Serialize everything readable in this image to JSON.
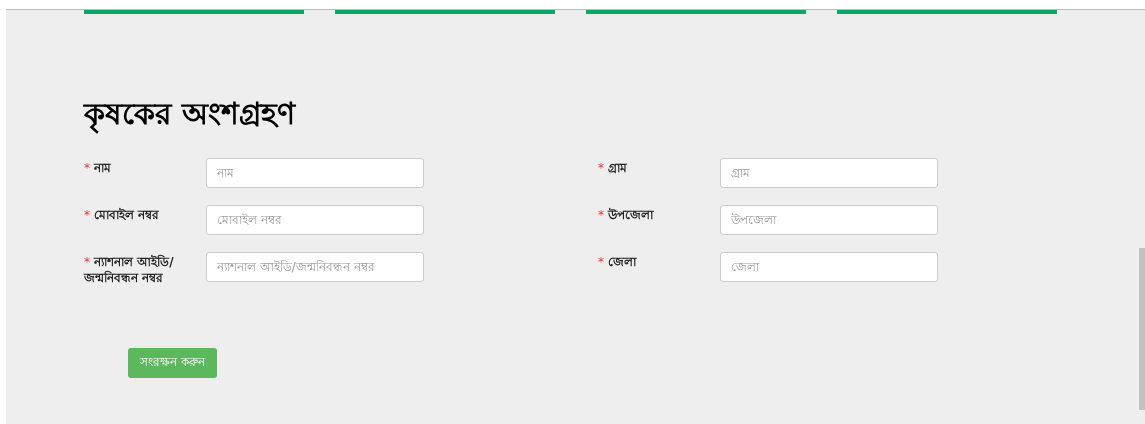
{
  "top_tabs": [
    {
      "kind": "bar"
    },
    {
      "kind": "bar"
    },
    {
      "kind": "bar"
    },
    {
      "kind": "bar"
    }
  ],
  "title": "কৃষকের অংশগ্রহণ",
  "fields": [
    {
      "mark": "*",
      "label": "নাম",
      "placeholder": "নাম"
    },
    {
      "mark": "*",
      "label": "গ্রাম",
      "placeholder": "গ্রাম"
    },
    {
      "mark": "*",
      "label": "মোবাইল নম্বর",
      "placeholder": "মোবাইল নম্বর"
    },
    {
      "mark": "*",
      "label": "উপজেলা",
      "placeholder": "উপজেলা"
    },
    {
      "mark": "*",
      "label": "ন্যাশনাল আইডি/ জন্মনিবন্ধন নম্বর",
      "placeholder": "ন্যাশনাল আইডি/জন্মনিবন্ধন নম্বর"
    },
    {
      "mark": "*",
      "label": "জেলা",
      "placeholder": "জেলা"
    }
  ],
  "submit_button": "সংরক্ষন করুন"
}
